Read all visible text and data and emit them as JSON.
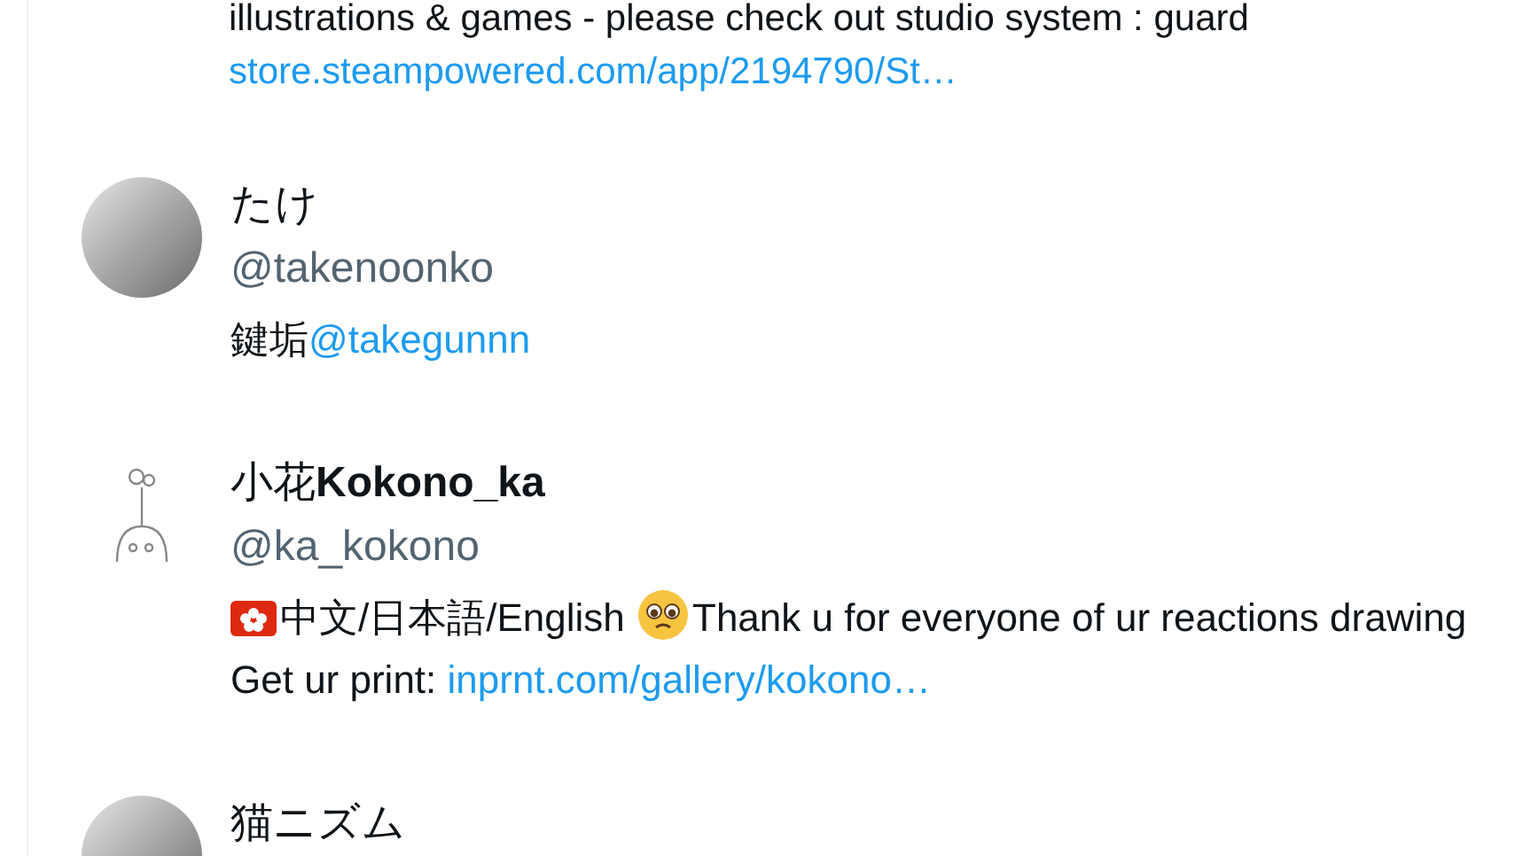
{
  "users": [
    {
      "kind": "continued",
      "bio": [
        {
          "kind": "text",
          "text": "illustrations & games - please check out studio system : guard"
        },
        {
          "kind": "link",
          "text": "store.steampowered.com/app/2194790/St…"
        }
      ]
    },
    {
      "kind": "full",
      "avatar": {
        "kind": "grey"
      },
      "name": "たけ",
      "handle": "@takenoonko",
      "bio": [
        {
          "kind": "text",
          "text": "鍵垢"
        },
        {
          "kind": "link",
          "text": "@takegunnn"
        }
      ]
    },
    {
      "kind": "full",
      "avatar": {
        "kind": "sketch"
      },
      "name": "小花**Kokono_ka**",
      "handle": "@ka_kokono",
      "bio": [
        {
          "kind": "flag"
        },
        {
          "kind": "text",
          "text": "中文/日本語/English "
        },
        {
          "kind": "emoji"
        },
        {
          "kind": "text",
          "text": "Thank u for everyone of ur reactions drawing Get ur print: "
        },
        {
          "kind": "link",
          "text": "inprnt.com/gallery/kokono…"
        }
      ]
    },
    {
      "kind": "partial",
      "avatar": {
        "kind": "grey"
      },
      "name": "猫ニズム"
    }
  ]
}
